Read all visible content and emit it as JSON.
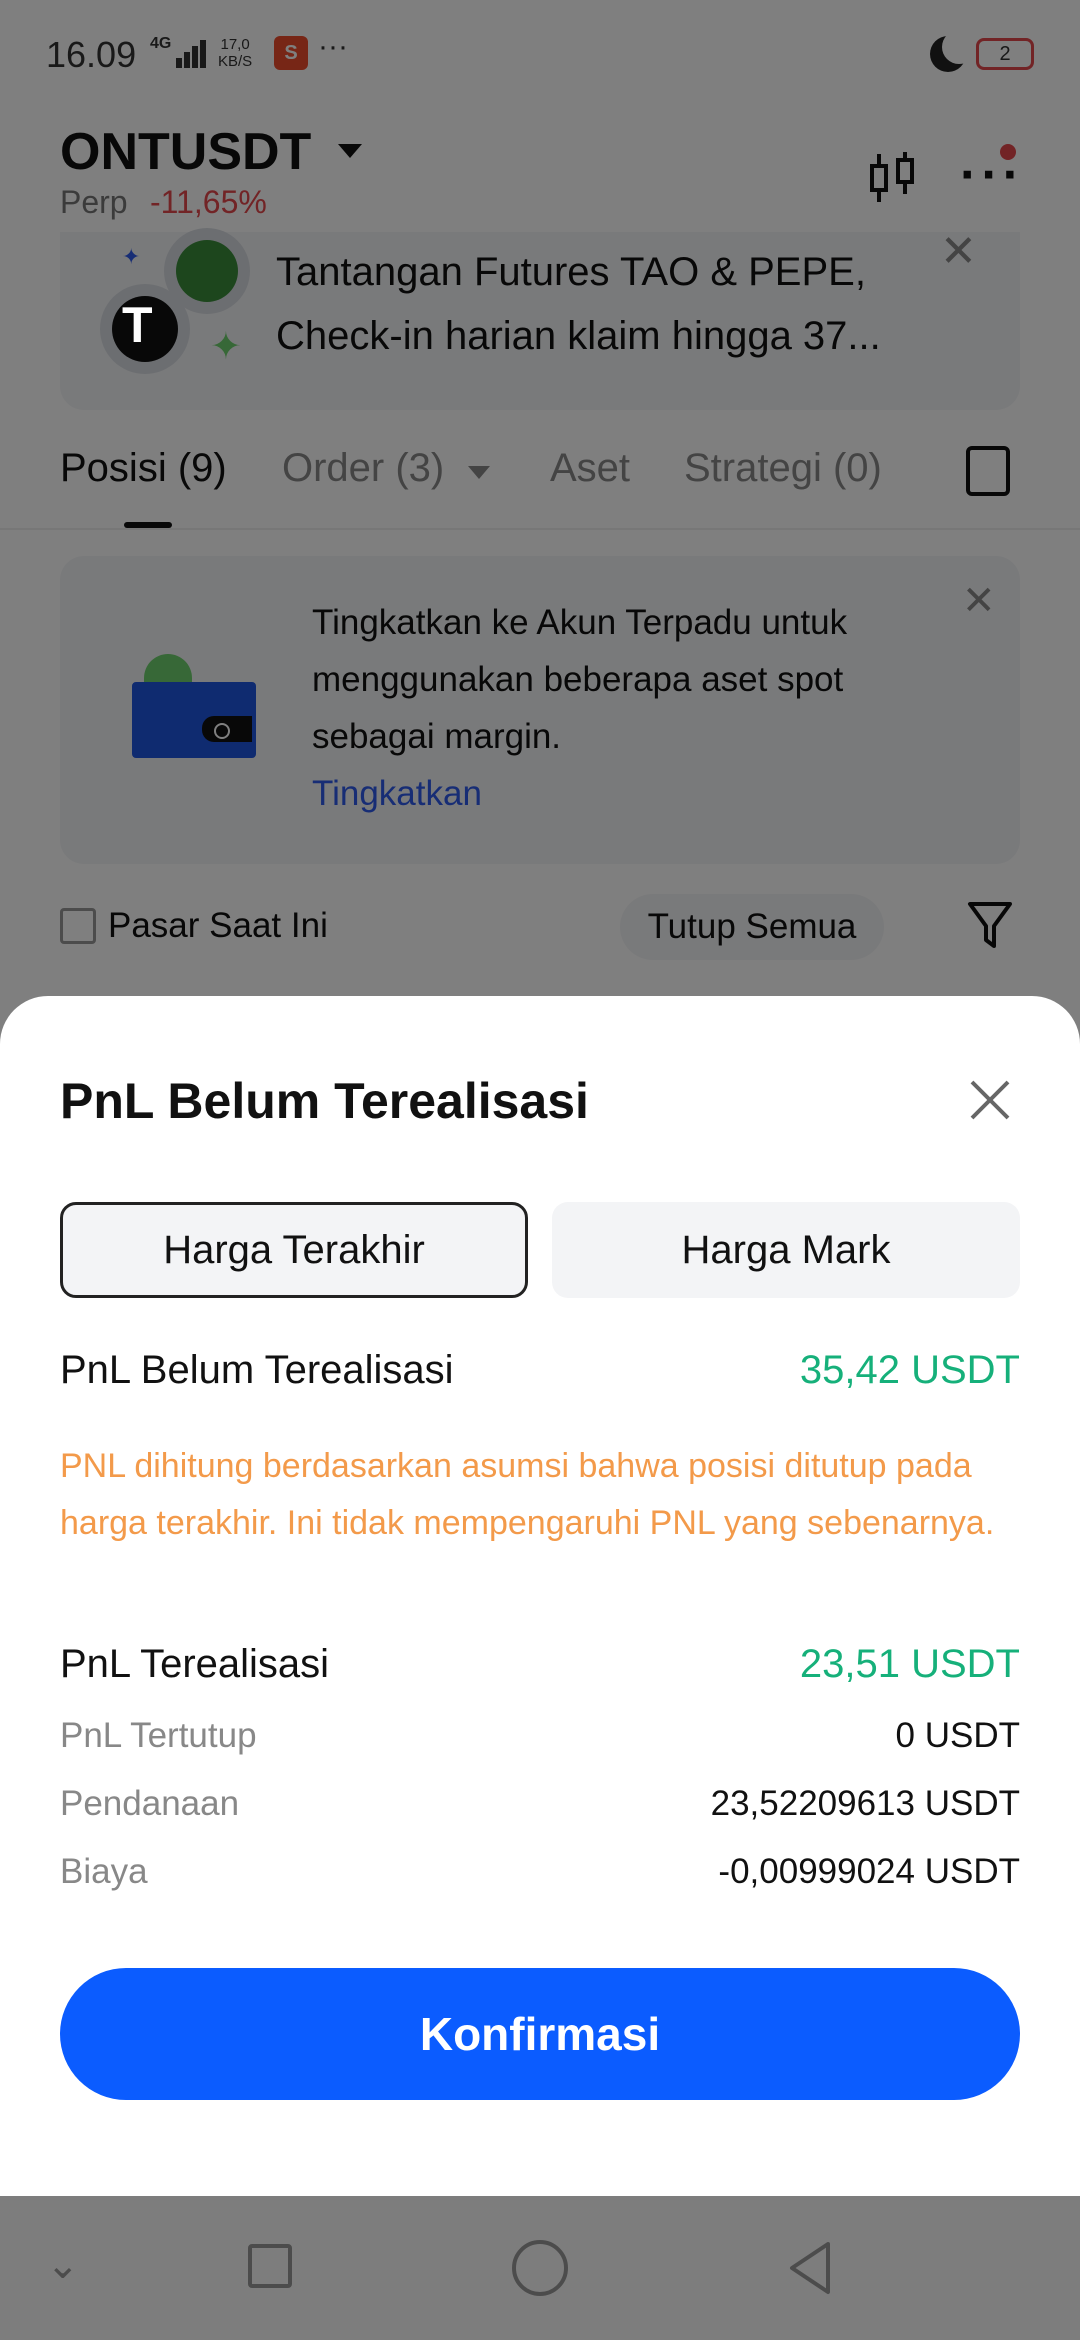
{
  "status_bar": {
    "time": "16.09",
    "network": "4G",
    "speed_value": "17,0",
    "speed_unit": "KB/S",
    "battery": "2",
    "shop_icon": "shopee-bag-icon",
    "more": "···"
  },
  "header": {
    "pair": "ONTUSDT",
    "market_type": "Perp",
    "change": "-11,65%"
  },
  "promo": {
    "badge": "T",
    "text": "Tantangan Futures TAO & PEPE, Check-in harian klaim hingga 37..."
  },
  "tabs": [
    {
      "label": "Posisi (9)"
    },
    {
      "label": "Order (3)"
    },
    {
      "label": "Aset"
    },
    {
      "label": "Strategi (0)"
    }
  ],
  "upgrade_card": {
    "text": "Tingkatkan ke Akun Terpadu untuk menggunakan beberapa aset spot sebagai margin.",
    "link": "Tingkatkan"
  },
  "filter_row": {
    "checkbox_label": "Pasar Saat Ini",
    "close_all": "Tutup Semua"
  },
  "sheet": {
    "title": "PnL Belum Terealisasi",
    "segments": [
      "Harga Terakhir",
      "Harga Mark"
    ],
    "active_segment": 0,
    "unrealized_label": "PnL Belum Terealisasi",
    "unrealized_value": "35,42 USDT",
    "note": "PNL dihitung berdasarkan asumsi bahwa posisi ditutup pada harga terakhir. Ini tidak mempengaruhi PNL yang sebenarnya.",
    "realized_label": "PnL Terealisasi",
    "realized_value": "23,51 USDT",
    "details": [
      {
        "label": "PnL Tertutup",
        "value": "0 USDT"
      },
      {
        "label": "Pendanaan",
        "value": "23,52209613 USDT"
      },
      {
        "label": "Biaya",
        "value": "-0,00999024 USDT"
      }
    ],
    "confirm": "Konfirmasi"
  },
  "colors": {
    "accent": "#0b5cff",
    "positive": "#16b07a",
    "negative": "#e5484d",
    "warning": "#f39a4a",
    "link": "#2f5bea"
  }
}
